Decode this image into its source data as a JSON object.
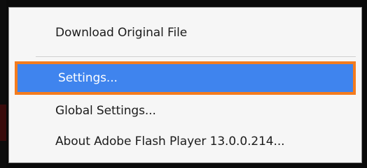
{
  "context_menu": {
    "items": [
      {
        "label": "Download Original File"
      },
      {
        "label": "Settings..."
      },
      {
        "label": "Global Settings..."
      },
      {
        "label": "About Adobe Flash Player 13.0.0.214..."
      }
    ],
    "highlighted_item": "Settings...",
    "colors": {
      "highlight_background": "#3f84ee",
      "highlight_border": "#f47c1e",
      "menu_background": "#f6f6f6"
    }
  }
}
